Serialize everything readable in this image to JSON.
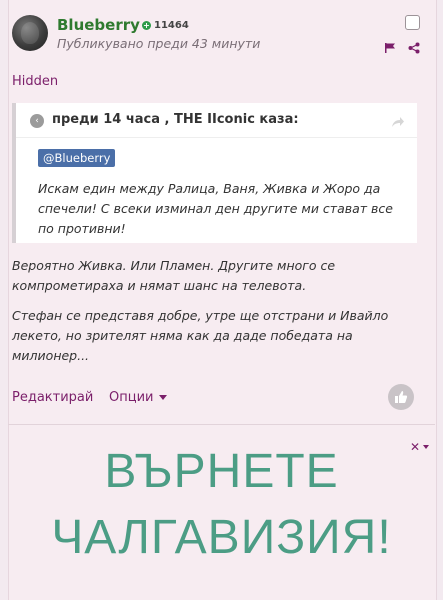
{
  "post": {
    "username": "Blueberry",
    "reputation": "11464",
    "posted": "Публикувано преди 43 минути",
    "hidden_label": "Hidden",
    "quote": {
      "title": "преди 14 часа , THE IIconic каза:",
      "mention": "@Blueberry",
      "text": "Искам един между Ралица, Ваня, Живка и Жоро да спечели! С всеки изминал ден другите ми стават все по противни!"
    },
    "paragraph1": "Вероятно Живка. Или Пламен. Другите много се компрометираха и нямат шанс на телевота.",
    "paragraph2": "Стефан се представя добре, утре ще отстрани и Ивайло лекето, но зрителят няма как да даде победата на милионер...",
    "edit_label": "Редактирай",
    "options_label": "Опции"
  },
  "ad": {
    "line1": "ВЪРНЕТЕ",
    "line2": "ЧАЛГАВИЗИЯ!"
  },
  "colors": {
    "accent": "#7b1f6a",
    "username": "#2f7a2f",
    "mention_bg": "#4b6fa8",
    "ad_text": "#4c9d85"
  }
}
